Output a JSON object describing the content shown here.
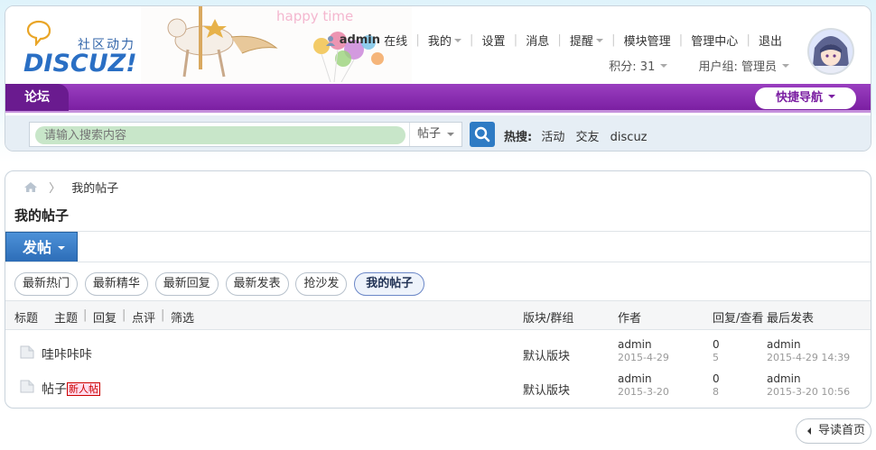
{
  "header": {
    "logo_slogan": "社区动力",
    "logo_wordmark": "DISCUZ!",
    "banner_text": "happy time",
    "user": {
      "username": "admin",
      "status": "在线",
      "links": [
        "我的",
        "设置",
        "消息",
        "提醒",
        "模块管理",
        "管理中心",
        "退出"
      ],
      "points_label": "积分: 31",
      "group_label": "用户组: 管理员"
    }
  },
  "nav": {
    "forum_label": "论坛",
    "quick_nav_label": "快捷导航"
  },
  "search": {
    "placeholder": "请输入搜索内容",
    "type_label": "帖子",
    "hot_label": "热搜:",
    "hot_keywords": [
      "活动",
      "交友",
      "discuz"
    ]
  },
  "main": {
    "breadcrumb_current": "我的帖子",
    "page_title": "我的帖子",
    "post_button": "发帖",
    "tabs": [
      "最新热门",
      "最新精华",
      "最新回复",
      "最新发表",
      "抢沙发",
      "我的帖子"
    ],
    "active_tab": "我的帖子",
    "table_headers": {
      "title": "标题",
      "filters": [
        "主题",
        "回复",
        "点评",
        "筛选"
      ],
      "forum": "版块/群组",
      "author": "作者",
      "replies_views": "回复/查看",
      "last_post": "最后发表"
    },
    "rows": [
      {
        "title": "哇咔咔咔",
        "tag": "",
        "forum": "默认版块",
        "author": "admin",
        "author_date": "2015-4-29",
        "replies": "0",
        "views": "5",
        "last_author": "admin",
        "last_date": "2015-4-29 14:39"
      },
      {
        "title": "帖子",
        "tag": "新人帖",
        "forum": "默认版块",
        "author": "admin",
        "author_date": "2015-3-20",
        "replies": "0",
        "views": "8",
        "last_author": "admin",
        "last_date": "2015-3-20 10:56"
      }
    ]
  },
  "footer": {
    "guide_home": "导读首页"
  },
  "colors": {
    "nav_purple": "#7b1fa2",
    "search_button": "#2e7bc4",
    "post_button": "#2d6db8",
    "search_input_bg": "#c8e6c9"
  }
}
